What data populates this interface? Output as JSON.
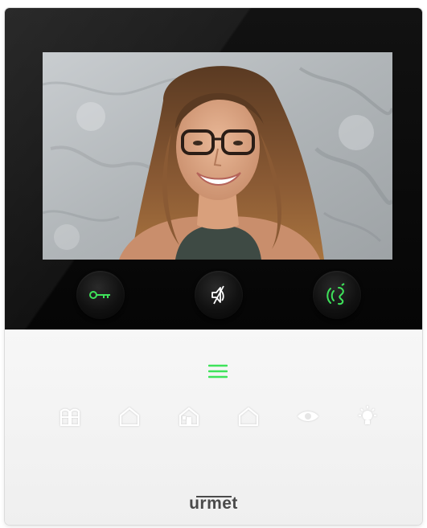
{
  "device": {
    "brand": "urmet"
  },
  "screen": {
    "content": "video-feed-portrait"
  },
  "buttons": [
    {
      "id": "door-open",
      "icon": "key-icon"
    },
    {
      "id": "mute",
      "icon": "muted-speaker-icon"
    },
    {
      "id": "talk",
      "icon": "handset-talk-icon"
    }
  ],
  "function_keys": [
    {
      "id": "gate",
      "icon": "gate-icon"
    },
    {
      "id": "intercom-1",
      "icon": "home-outline-icon"
    },
    {
      "id": "intercom-2",
      "icon": "home-with-door-icon"
    },
    {
      "id": "intercom-3",
      "icon": "home-outline-icon"
    },
    {
      "id": "camera-view",
      "icon": "eye-icon"
    },
    {
      "id": "light",
      "icon": "light-bulb-icon"
    }
  ],
  "colors": {
    "accent_green": "#3ee35a",
    "panel_black": "#0b0b0b",
    "panel_white": "#f4f4f4",
    "icon_white": "#ffffff",
    "brand_text": "#4a4a4a"
  },
  "menu": {
    "icon": "menu-icon"
  }
}
